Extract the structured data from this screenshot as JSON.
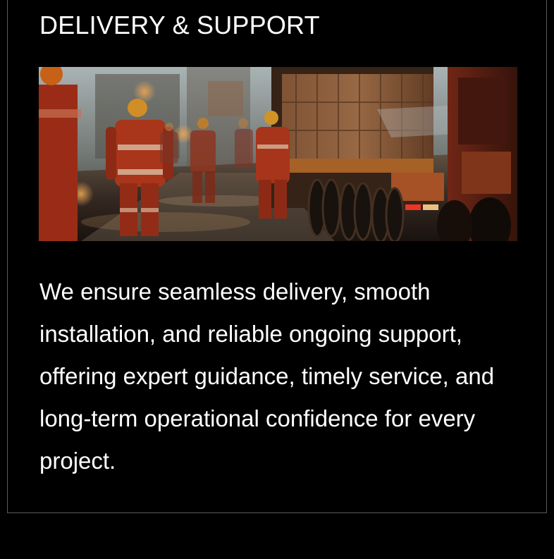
{
  "section": {
    "title": "DELIVERY & SUPPORT",
    "image_alt": "workers in safety gear walking beside loaded freight trucks",
    "description": "We ensure seamless delivery, smooth installation, and reliable ongoing support, offering expert guidance, timely service, and long-term operational confidence for every project."
  },
  "colors": {
    "background": "#000000",
    "text": "#ffffff",
    "border": "#5a5a5a",
    "safety_orange": "#c2401f"
  }
}
